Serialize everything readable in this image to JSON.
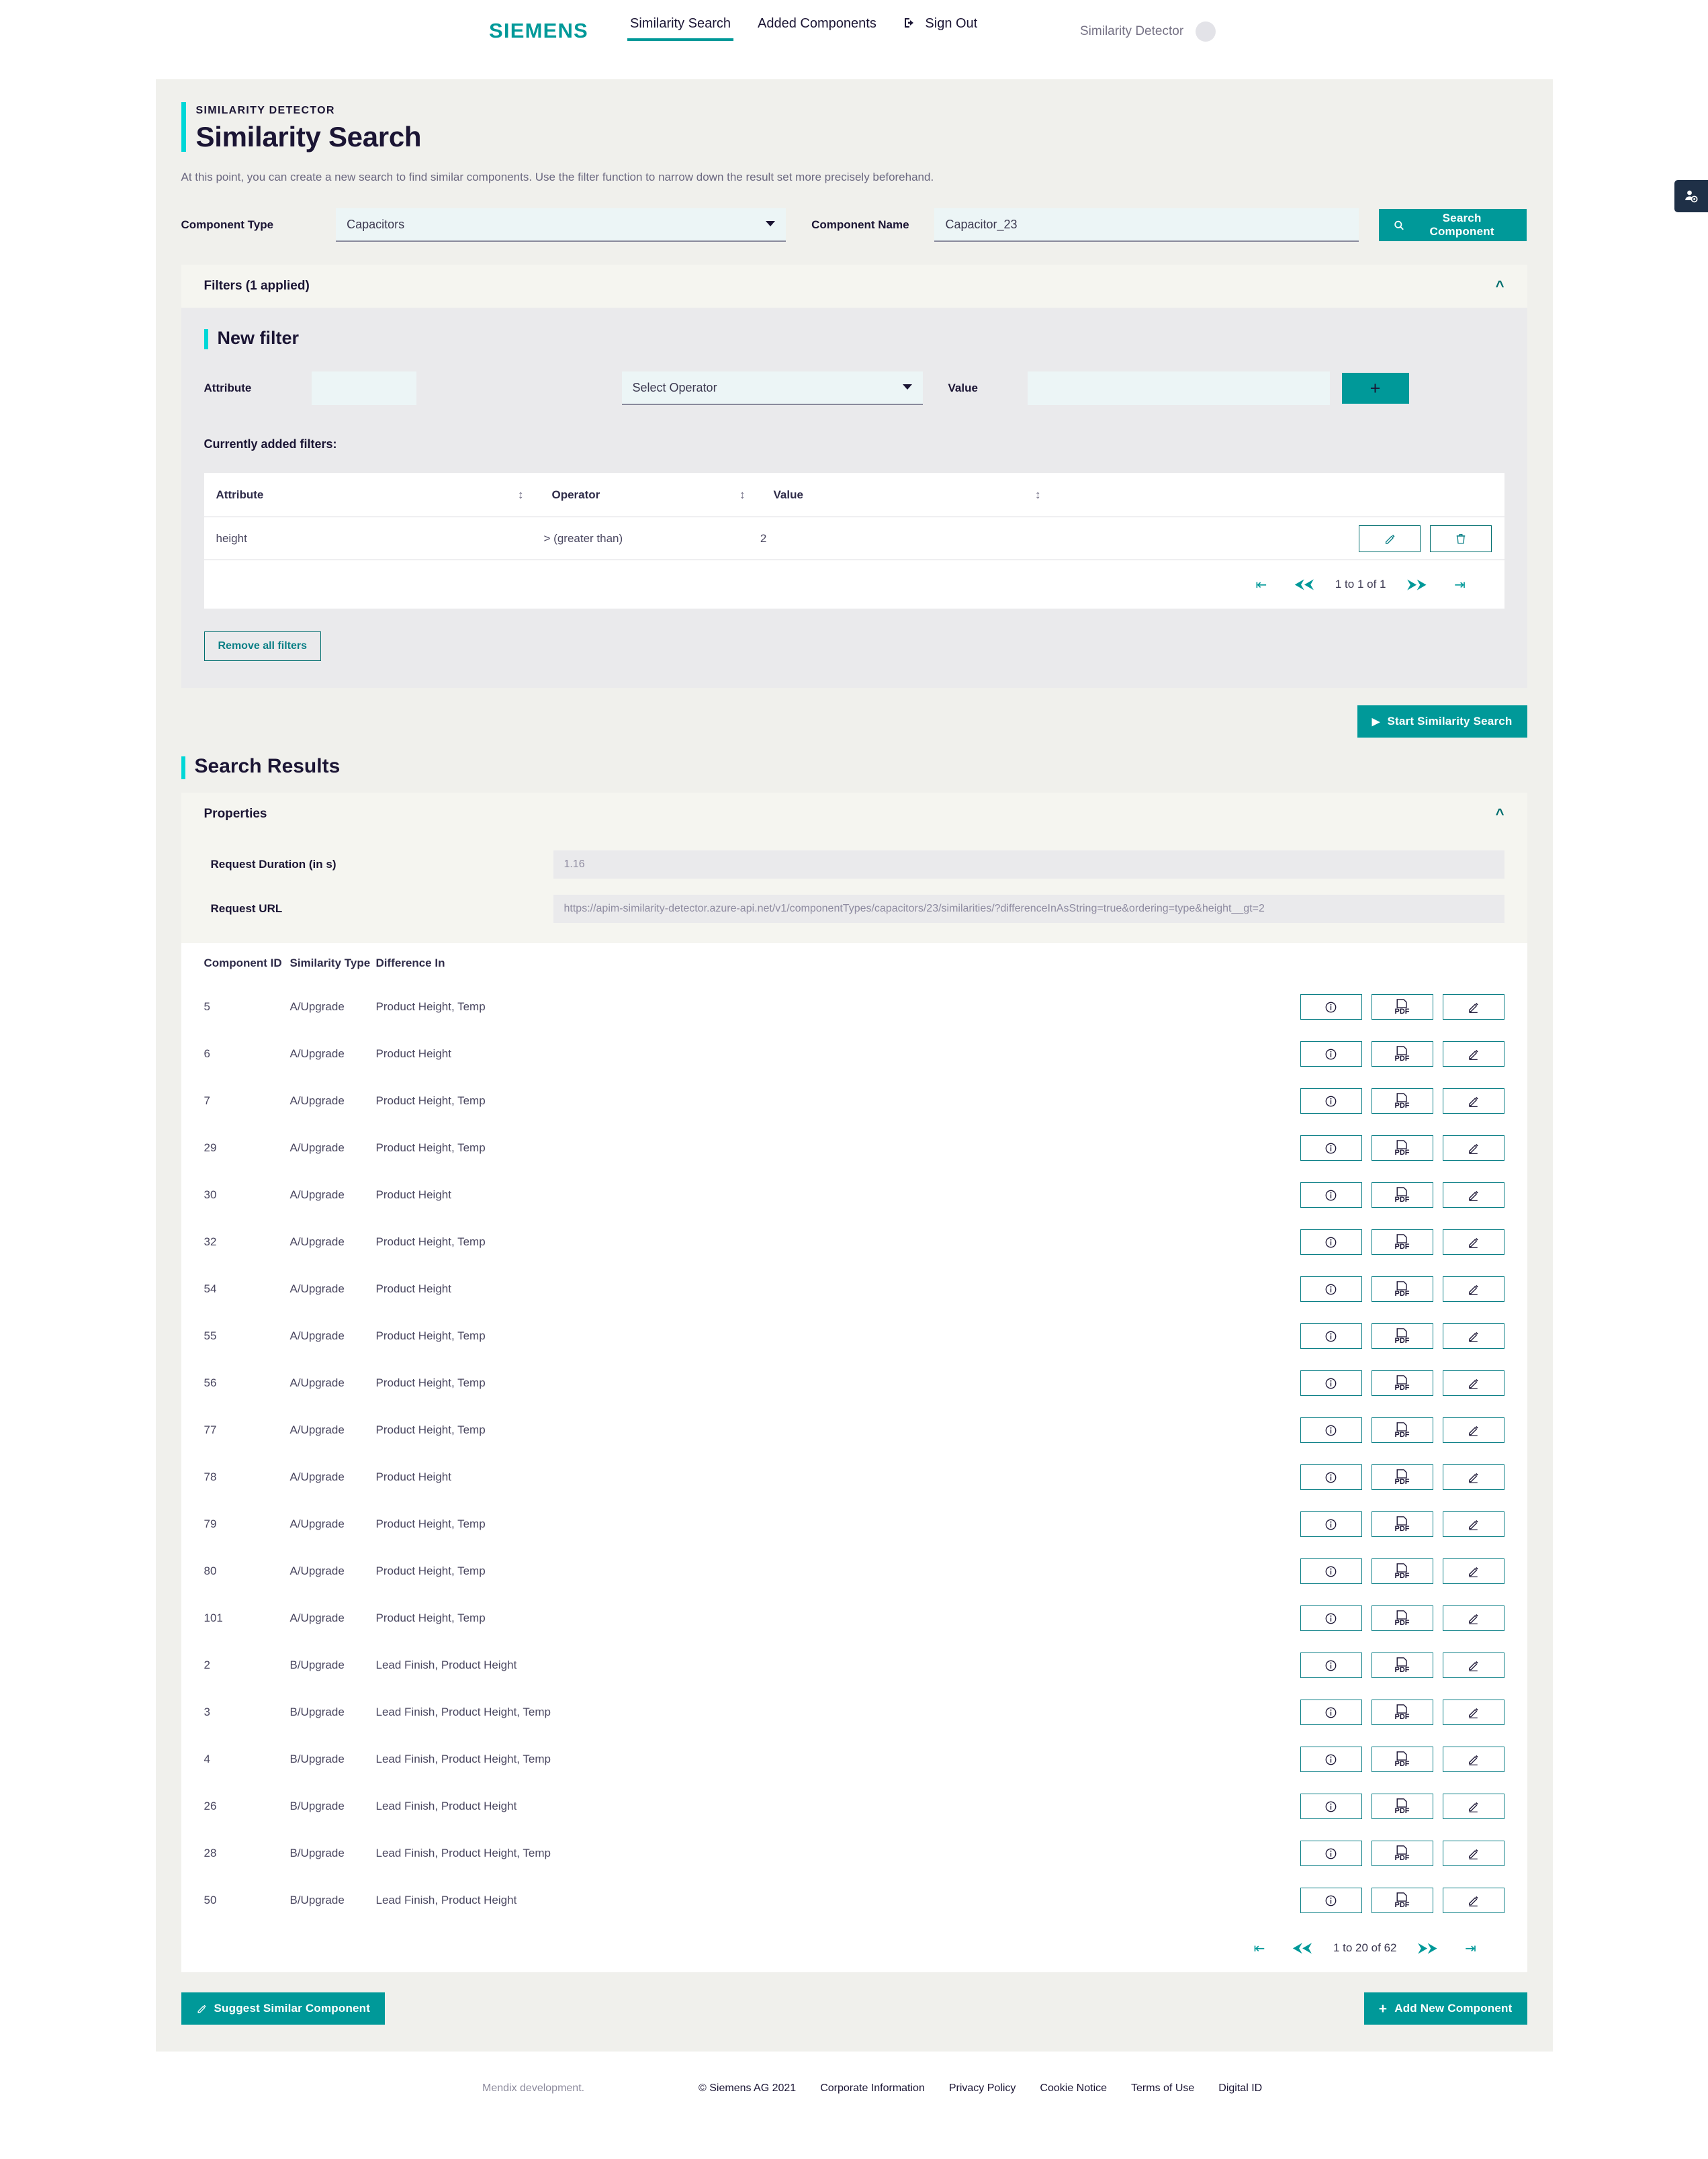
{
  "header": {
    "logo": "SIEMENS",
    "nav": [
      {
        "label": "Similarity Search",
        "active": true
      },
      {
        "label": "Added Components",
        "active": false
      },
      {
        "label": "Sign Out",
        "active": false,
        "icon": "sign-out-icon"
      }
    ],
    "user_label": "Similarity Detector"
  },
  "page": {
    "eyebrow": "SIMILARITY DETECTOR",
    "title": "Similarity Search",
    "intro": "At this point, you can create a new search to find similar components. Use the filter function to narrow down the result set more precisely beforehand."
  },
  "search": {
    "component_type_label": "Component Type",
    "component_type_value": "Capacitors",
    "component_name_label": "Component Name",
    "component_name_value": "Capacitor_23",
    "search_button": "Search Component"
  },
  "filters": {
    "panel_title": "Filters (1 applied)",
    "new_filter_title": "New filter",
    "attribute_label": "Attribute",
    "attribute_value": "",
    "operator_label": "Operator",
    "operator_value": "Select Operator",
    "value_label": "Value",
    "value_value": "",
    "add_button": "+",
    "currently_added_label": "Currently added filters:",
    "columns": [
      "Attribute",
      "Operator",
      "Value"
    ],
    "rows": [
      {
        "attribute": "height",
        "operator": "> (greater than)",
        "value": "2"
      }
    ],
    "pagination": "1 to 1 of 1",
    "remove_all_button": "Remove all filters"
  },
  "start_search_button": "Start Similarity Search",
  "results": {
    "section_title": "Search Results",
    "properties_title": "Properties",
    "request_duration_label": "Request Duration (in s)",
    "request_duration_value": "1.16",
    "request_url_label": "Request URL",
    "request_url_value": "https://apim-similarity-detector.azure-api.net/v1/componentTypes/capacitors/23/similarities/?differenceInAsString=true&ordering=type&height__gt=2",
    "columns": [
      "Component ID",
      "Similarity Type",
      "Difference In"
    ],
    "rows": [
      {
        "id": "5",
        "type": "A/Upgrade",
        "difference": "Product Height, Temp"
      },
      {
        "id": "6",
        "type": "A/Upgrade",
        "difference": "Product Height"
      },
      {
        "id": "7",
        "type": "A/Upgrade",
        "difference": "Product Height, Temp"
      },
      {
        "id": "29",
        "type": "A/Upgrade",
        "difference": "Product Height, Temp"
      },
      {
        "id": "30",
        "type": "A/Upgrade",
        "difference": "Product Height"
      },
      {
        "id": "32",
        "type": "A/Upgrade",
        "difference": "Product Height, Temp"
      },
      {
        "id": "54",
        "type": "A/Upgrade",
        "difference": "Product Height"
      },
      {
        "id": "55",
        "type": "A/Upgrade",
        "difference": "Product Height, Temp"
      },
      {
        "id": "56",
        "type": "A/Upgrade",
        "difference": "Product Height, Temp"
      },
      {
        "id": "77",
        "type": "A/Upgrade",
        "difference": "Product Height, Temp"
      },
      {
        "id": "78",
        "type": "A/Upgrade",
        "difference": "Product Height"
      },
      {
        "id": "79",
        "type": "A/Upgrade",
        "difference": "Product Height, Temp"
      },
      {
        "id": "80",
        "type": "A/Upgrade",
        "difference": "Product Height, Temp"
      },
      {
        "id": "101",
        "type": "A/Upgrade",
        "difference": "Product Height, Temp"
      },
      {
        "id": "2",
        "type": "B/Upgrade",
        "difference": "Lead Finish, Product Height"
      },
      {
        "id": "3",
        "type": "B/Upgrade",
        "difference": "Lead Finish, Product Height, Temp"
      },
      {
        "id": "4",
        "type": "B/Upgrade",
        "difference": "Lead Finish, Product Height, Temp"
      },
      {
        "id": "26",
        "type": "B/Upgrade",
        "difference": "Lead Finish, Product Height"
      },
      {
        "id": "28",
        "type": "B/Upgrade",
        "difference": "Lead Finish, Product Height, Temp"
      },
      {
        "id": "50",
        "type": "B/Upgrade",
        "difference": "Lead Finish, Product Height"
      }
    ],
    "pagination": "1 to 20 of 62",
    "pdf_label": "PDF"
  },
  "bottom": {
    "suggest_button": "Suggest Similar Component",
    "add_button": "Add New Component"
  },
  "footer": {
    "dev_note": "Mendix development.",
    "copyright": "© Siemens AG 2021",
    "links": [
      "Corporate Information",
      "Privacy Policy",
      "Cookie Notice",
      "Terms of Use",
      "Digital ID"
    ]
  },
  "colors": {
    "teal": "#009999",
    "cyan_accent": "#00d7d7",
    "dark": "#1b1534"
  }
}
